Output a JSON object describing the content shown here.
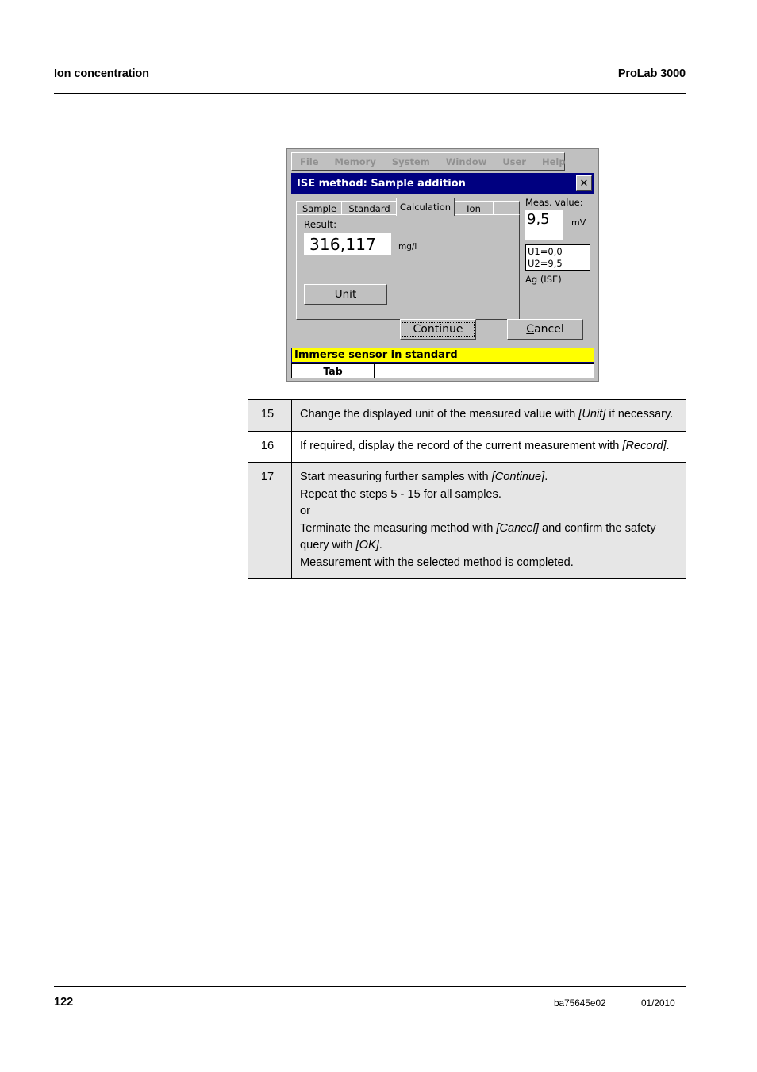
{
  "header": {
    "left": "Ion concentration",
    "right": "ProLab 3000"
  },
  "dialog": {
    "menubar": [
      "File",
      "Memory",
      "System",
      "Window",
      "User",
      "Help"
    ],
    "title": "ISE method:  Sample addition",
    "close_icon": "close-icon",
    "close_glyph": "✕",
    "tabs": [
      {
        "label": "Sample",
        "active": false
      },
      {
        "label": "Standard",
        "active": false
      },
      {
        "label": "Calculation",
        "active": true
      },
      {
        "label": "Ion",
        "active": false
      }
    ],
    "result_label": "Result:",
    "result_value": "316,117",
    "result_unit": "mg/l",
    "unit_button": "Unit",
    "meas": {
      "title": "Meas. value:",
      "value": "9,5",
      "unit": "mV",
      "u1": "U1=0,0",
      "u2": "U2=9,5",
      "sensor": "Ag (ISE)"
    },
    "buttons": {
      "continue": "Continue",
      "cancel_accel": "C",
      "cancel_rest": "ancel"
    },
    "status_message": "Immerse sensor in standard",
    "status_tab": "Tab",
    "colors": {
      "titlebar": "#000080",
      "face": "#c0c0c0",
      "status_highlight": "#ffff00",
      "field": "#ffffff"
    }
  },
  "steps": [
    {
      "number": "15",
      "shaded": true,
      "lines": [
        [
          {
            "t": "Change the displayed unit of the measured value with ",
            "i": false
          },
          {
            "t": "[Unit]",
            "i": true
          },
          {
            "t": " if necessary.",
            "i": false
          }
        ]
      ]
    },
    {
      "number": "16",
      "shaded": false,
      "lines": [
        [
          {
            "t": "If required, display the record of the current measurement with ",
            "i": false
          },
          {
            "t": "[Record]",
            "i": true
          },
          {
            "t": ".",
            "i": false
          }
        ]
      ]
    },
    {
      "number": "17",
      "shaded": true,
      "lines": [
        [
          {
            "t": "Start measuring further samples with ",
            "i": false
          },
          {
            "t": "[Continue]",
            "i": true
          },
          {
            "t": ".",
            "i": false
          }
        ],
        [
          {
            "t": "Repeat the steps 5 - 15 for all samples.",
            "i": false
          }
        ],
        [
          {
            "t": "or",
            "i": false
          }
        ],
        [
          {
            "t": "Terminate the measuring method with ",
            "i": false
          },
          {
            "t": "[Cancel]",
            "i": true
          },
          {
            "t": " and confirm the safety query with ",
            "i": false
          },
          {
            "t": "[OK]",
            "i": true
          },
          {
            "t": ".",
            "i": false
          }
        ],
        [
          {
            "t": "Measurement with the selected method is completed.",
            "i": false
          }
        ]
      ]
    }
  ],
  "footer": {
    "page": "122",
    "doc_number": "ba75645e02",
    "date": "01/2010"
  }
}
